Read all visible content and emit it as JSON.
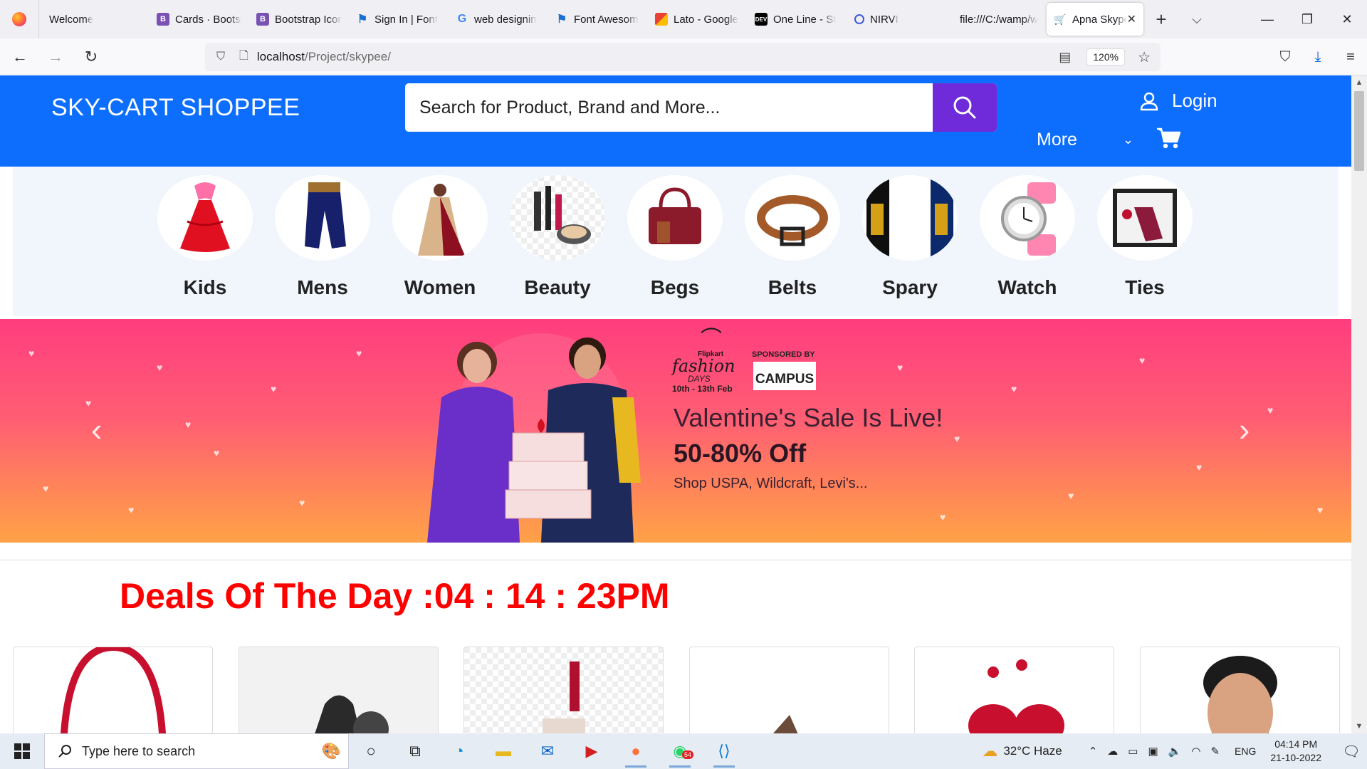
{
  "browser": {
    "tabs": [
      {
        "label": "Welcome",
        "icon": "firefox-icon",
        "color": "#ff7139"
      },
      {
        "label": "Cards · Bootst",
        "icon": "bootstrap-icon",
        "color": "#7952b3"
      },
      {
        "label": "Bootstrap Icon",
        "icon": "bootstrap-icon",
        "color": "#7952b3"
      },
      {
        "label": "Sign In | Font",
        "icon": "flag-icon",
        "color": "#1c6fd2"
      },
      {
        "label": "web designin",
        "icon": "google-icon",
        "color": "#4285f4"
      },
      {
        "label": "Font Awesom",
        "icon": "flag-icon",
        "color": "#1c6fd2"
      },
      {
        "label": "Lato - Google",
        "icon": "google-fonts-icon",
        "color": "#e94235"
      },
      {
        "label": "One Line - St",
        "icon": "dev-icon",
        "color": "#000000"
      },
      {
        "label": "NIRVI",
        "icon": "nirvi-icon",
        "color": "#3b5bdb"
      },
      {
        "label": "file:///C:/wamp/w",
        "icon": "",
        "color": ""
      },
      {
        "label": "Apna Skype",
        "icon": "site-icon",
        "color": "#2f9fe0"
      }
    ],
    "url_host": "localhost",
    "url_path": "/Project/skypee/",
    "zoom": "120%"
  },
  "site": {
    "brand": "SKY-CART SHOPPEE",
    "search_placeholder": "Search for Product, Brand and More...",
    "login": "Login",
    "more": "More",
    "accent": "#0d6efd",
    "search_button_color": "#6f2bd9"
  },
  "categories": [
    {
      "label": "Kids"
    },
    {
      "label": "Mens"
    },
    {
      "label": "Women"
    },
    {
      "label": "Beauty"
    },
    {
      "label": "Begs"
    },
    {
      "label": "Belts"
    },
    {
      "label": "Spary"
    },
    {
      "label": "Watch"
    },
    {
      "label": "Ties"
    }
  ],
  "banner": {
    "brand_small": "Flipkart",
    "brand_fashion": "fashion",
    "brand_days": "DAYS",
    "dates": "10th - 13th Feb",
    "sponsored_by": "SPONSORED BY",
    "sponsor": "CAMPUS",
    "headline": "Valentine's Sale Is Live!",
    "offer": "50-80% Off",
    "sub": "Shop USPA, Wildcraft, Levi's..."
  },
  "deals": {
    "title": "Deals Of The Day :04 : 14 : 23PM"
  },
  "taskbar": {
    "search_placeholder": "Type here to search",
    "weather": "32°C  Haze",
    "lang": "ENG",
    "time": "04:14 PM",
    "date": "21-10-2022",
    "whatsapp_badge": "54"
  }
}
